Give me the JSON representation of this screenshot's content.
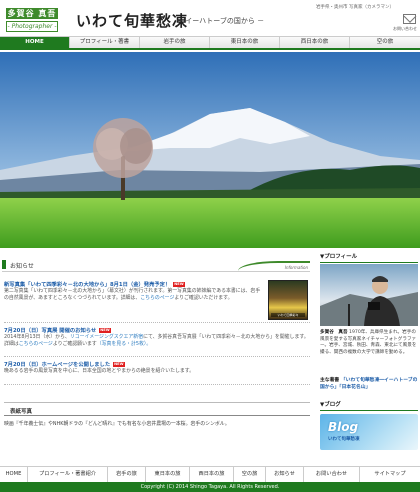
{
  "header": {
    "logo_name": "多賀谷 真吾",
    "logo_sub": "- Photographer -",
    "title": "いわて旬華愁凍",
    "subtitle": "－ イーハトーブの国から －",
    "tagline": "岩手県・奥州市 写真家（カメラマン）",
    "mail_label": "お問い合わせ"
  },
  "nav": {
    "items": [
      "HOME",
      "プロフィール・著書",
      "岩手の旅",
      "東日本の旅",
      "西日本の旅",
      "空の旅"
    ]
  },
  "notice": {
    "title": "お知らせ",
    "info_label": "Information"
  },
  "news": [
    {
      "title": "新写真集「いわて四季彩々－北の大地から」8月1日（金）発売予定！",
      "badge": "NEW",
      "text": "第二写真集「いわて四季彩々－北の大地から」（幕文社）が刊行されます。第一写真集の姉妹編である本書には、岩手の自然風景が、あますところなくつづられています。詳細は、",
      "link": "こちらのページ",
      "tail": "よりご確認いただけます。"
    },
    {
      "title": "7月20日（日）写真展 開催のお知らせ",
      "badge": "NEW",
      "date": "2014年8月13日（水）から、",
      "link": "リコーイメージングスクエア新宿",
      "text": "にて、多賀谷真吾写真展「いわて四季彩々－北の大地から」を開催します。詳細は",
      "link2": "こちらのページ",
      "tail": "よりご確認願います",
      "extra": "（写真を見る・計5枚）。"
    },
    {
      "title": "7月20日（日）ホームページを公開しました",
      "badge": "NEW",
      "text": "晩あるる岩手の風景写真を中心に、日本全国の地とやまからの絶景を紹介いたします。"
    }
  ],
  "thumb_label": "いわて四季彩々",
  "feature": {
    "title": "表紙写真",
    "text": "映画『千年義士伝』やNHK朝ドラの『どんど晴れ』でも有名な小岩井農場の一本桜。岩手のシンボル。"
  },
  "sidebar": {
    "profile_heading": "▼プロフィール",
    "profile_name": "多賀谷　真吾",
    "profile_text": "1970年、兵庫県生まれ。岩手の風景を愛する写真家ネイチャーフォトグラファー。岩手、宮城、秋田、青森、東北にて風景を撮る、関西の複数の大学で講師を勤める。",
    "works_label": "主な著書",
    "works_text": "「いわて旬華愁凍―イーハトーブの国から」「日本花名山」",
    "blog_heading": "▼ブログ",
    "blog_word": "Blog",
    "blog_sub": "いわて旬華愁凍"
  },
  "footer": {
    "items": [
      "HOME",
      "プロフィール・著書紹介",
      "岩手の旅",
      "東日本の旅",
      "西日本の旅",
      "空の旅",
      "お知らせ",
      "お問い合わせ",
      "サイトマップ"
    ],
    "copyright": "Copyright (C) 2014 Shingo Tagaya. All Rights Reserved."
  }
}
